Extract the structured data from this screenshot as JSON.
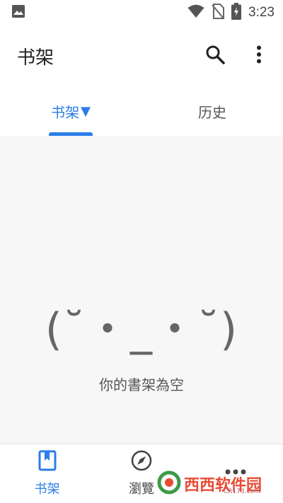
{
  "status_bar": {
    "time": "3:23",
    "icons": [
      "image-icon",
      "wifi-icon",
      "no-sim-icon",
      "battery-charging-icon"
    ]
  },
  "app_bar": {
    "title": "书架",
    "actions": [
      "search-icon",
      "more-vert-icon"
    ]
  },
  "tabs": [
    {
      "label": "书架",
      "caret": "▼",
      "active": true
    },
    {
      "label": "历史",
      "active": false
    }
  ],
  "empty_state": {
    "face": "(˘・_・˘)",
    "message": "你的書架為空"
  },
  "bottom_nav": [
    {
      "label": "书架",
      "icon": "bookmark-book-icon",
      "active": true
    },
    {
      "label": "瀏覽",
      "icon": "compass-icon",
      "active": false
    },
    {
      "label": "",
      "icon": "more-horiz-icon",
      "active": false
    }
  ],
  "watermark": {
    "text": "西西软件园",
    "sub": "CR173.com"
  },
  "colors": {
    "accent": "#2b7de9",
    "background": "#f7f7f7",
    "surface": "#ffffff",
    "watermark": "#e94b35"
  }
}
